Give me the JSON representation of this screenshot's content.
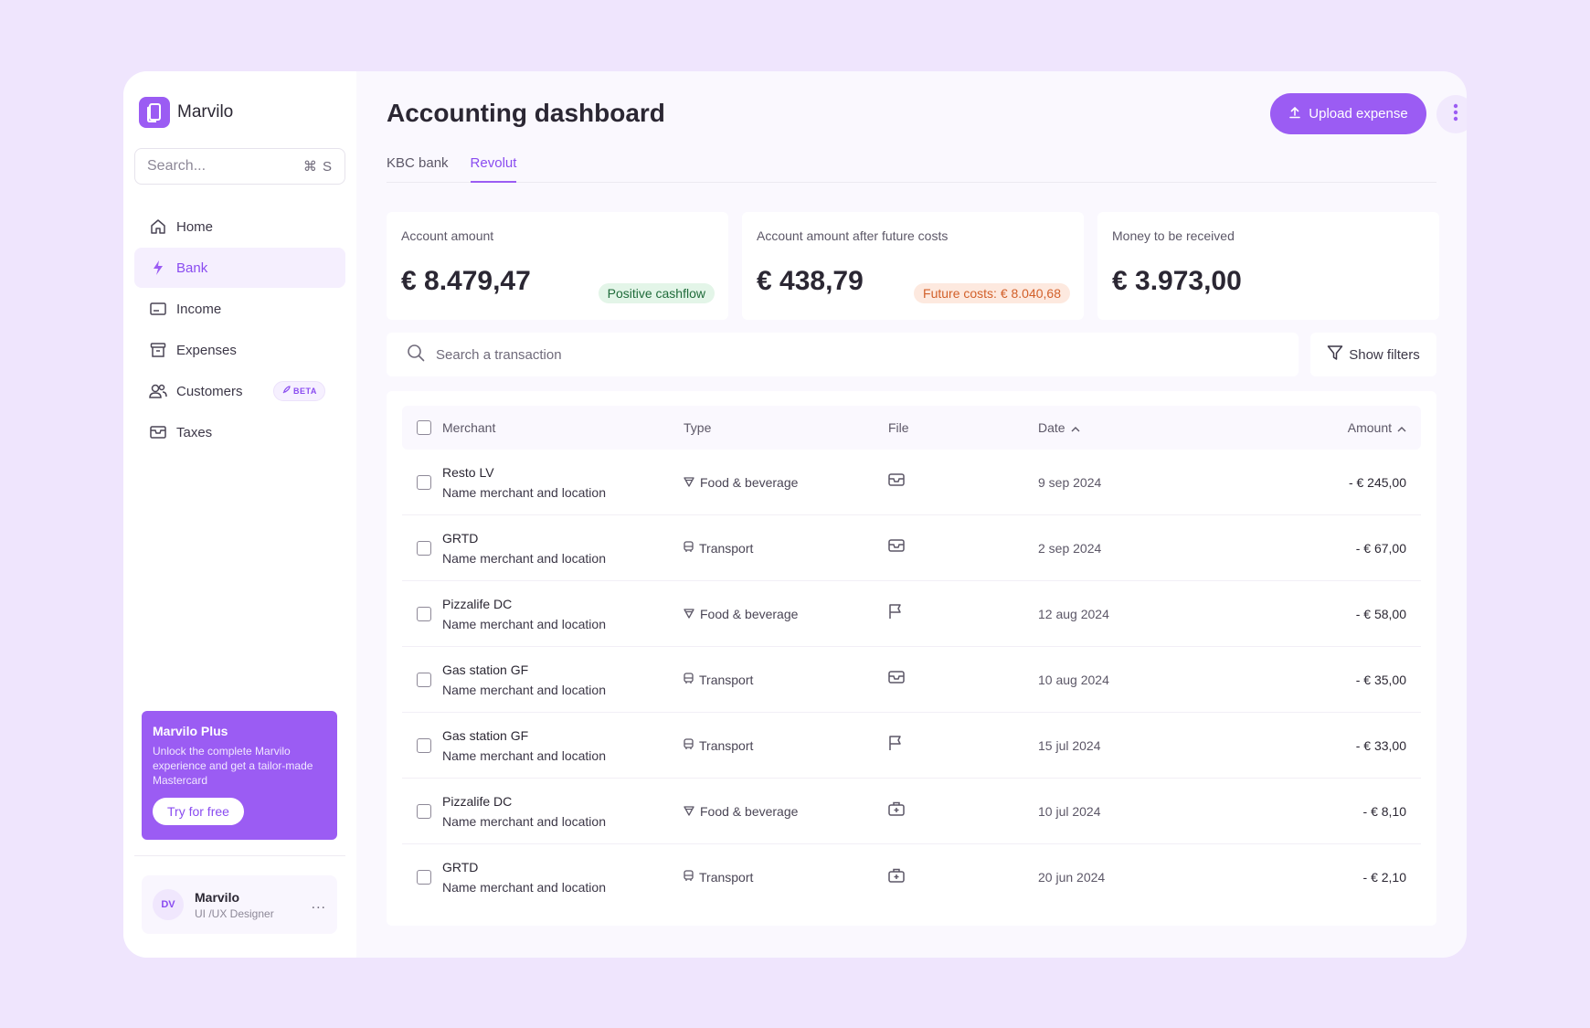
{
  "brand": {
    "name": "Marvilo"
  },
  "search": {
    "placeholder": "Search...",
    "shortcut": "⌘ S"
  },
  "nav": [
    {
      "label": "Home",
      "icon": "home-icon"
    },
    {
      "label": "Bank",
      "icon": "bolt-icon",
      "active": true
    },
    {
      "label": "Income",
      "icon": "card-icon"
    },
    {
      "label": "Expenses",
      "icon": "archive-icon"
    },
    {
      "label": "Customers",
      "icon": "users-icon",
      "badge": "BETA"
    },
    {
      "label": "Taxes",
      "icon": "inbox-icon"
    }
  ],
  "promo": {
    "title": "Marvilo Plus",
    "text": "Unlock the complete Marvilo experience and get a tailor-made Mastercard",
    "button": "Try for free"
  },
  "user": {
    "initials": "DV",
    "name": "Marvilo",
    "role": "UI /UX Designer",
    "more": "..."
  },
  "header": {
    "title": "Accounting dashboard",
    "upload_label": "Upload expense"
  },
  "tabs": [
    {
      "label": "KBC bank"
    },
    {
      "label": "Revolut",
      "active": true
    }
  ],
  "cards": [
    {
      "label": "Account amount",
      "value": "€ 8.479,47",
      "pill": "Positive cashflow"
    },
    {
      "label": "Account amount after future costs",
      "value": "€ 438,79",
      "pill": "Future costs: € 8.040,68"
    },
    {
      "label": "Money to be received",
      "value": "€ 3.973,00"
    }
  ],
  "tx_search": {
    "placeholder": "Search a transaction"
  },
  "filters": {
    "label": "Show filters"
  },
  "table": {
    "headers": {
      "merchant": "Merchant",
      "type": "Type",
      "file": "File",
      "date": "Date",
      "amount": "Amount"
    },
    "rows": [
      {
        "merchant": "Resto LV",
        "sub": "Name merchant and location",
        "type": "Food & beverage",
        "file_icon": "inbox-icon",
        "date": "9 sep 2024",
        "amount": "- € 245,00"
      },
      {
        "merchant": "GRTD",
        "sub": "Name merchant and location",
        "type": "Transport",
        "file_icon": "inbox-icon",
        "date": "2 sep 2024",
        "amount": "- € 67,00"
      },
      {
        "merchant": "Pizzalife DC",
        "sub": "Name merchant and location",
        "type": "Food & beverage",
        "file_icon": "flag-icon",
        "date": "12 aug 2024",
        "amount": "- € 58,00"
      },
      {
        "merchant": "Gas station GF",
        "sub": "Name merchant and location",
        "type": "Transport",
        "file_icon": "inbox-icon",
        "date": "10 aug 2024",
        "amount": "- € 35,00"
      },
      {
        "merchant": "Gas station GF",
        "sub": "Name merchant and location",
        "type": "Transport",
        "file_icon": "flag-icon",
        "date": "15 jul 2024",
        "amount": "- € 33,00"
      },
      {
        "merchant": "Pizzalife DC",
        "sub": "Name merchant and location",
        "type": "Food & beverage",
        "file_icon": "medkit-icon",
        "date": "10 jul 2024",
        "amount": "- € 8,10"
      },
      {
        "merchant": "GRTD",
        "sub": "Name merchant and location",
        "type": "Transport",
        "file_icon": "medkit-icon",
        "date": "20 jun 2024",
        "amount": "- € 2,10"
      }
    ]
  },
  "colors": {
    "accent": "#9b5cf3",
    "background": "#efe5fd",
    "positive": "#1f6b3a",
    "warning": "#d2602a"
  }
}
